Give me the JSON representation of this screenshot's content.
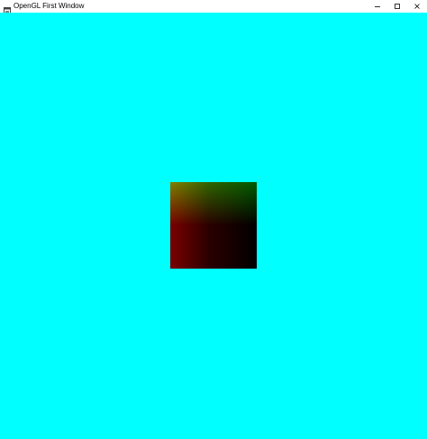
{
  "window": {
    "title": "OpenGL First Window"
  },
  "titlebar_icons": {
    "app": "app-window-icon",
    "minimize": "minimize-icon",
    "maximize": "maximize-icon",
    "close": "close-icon"
  },
  "scene": {
    "clear_color": "#00ffff",
    "quad_corner_colors": {
      "top_left": "#808000",
      "top_right": "#005a00",
      "bottom_left": "#7a0000",
      "bottom_right": "#000000"
    }
  }
}
